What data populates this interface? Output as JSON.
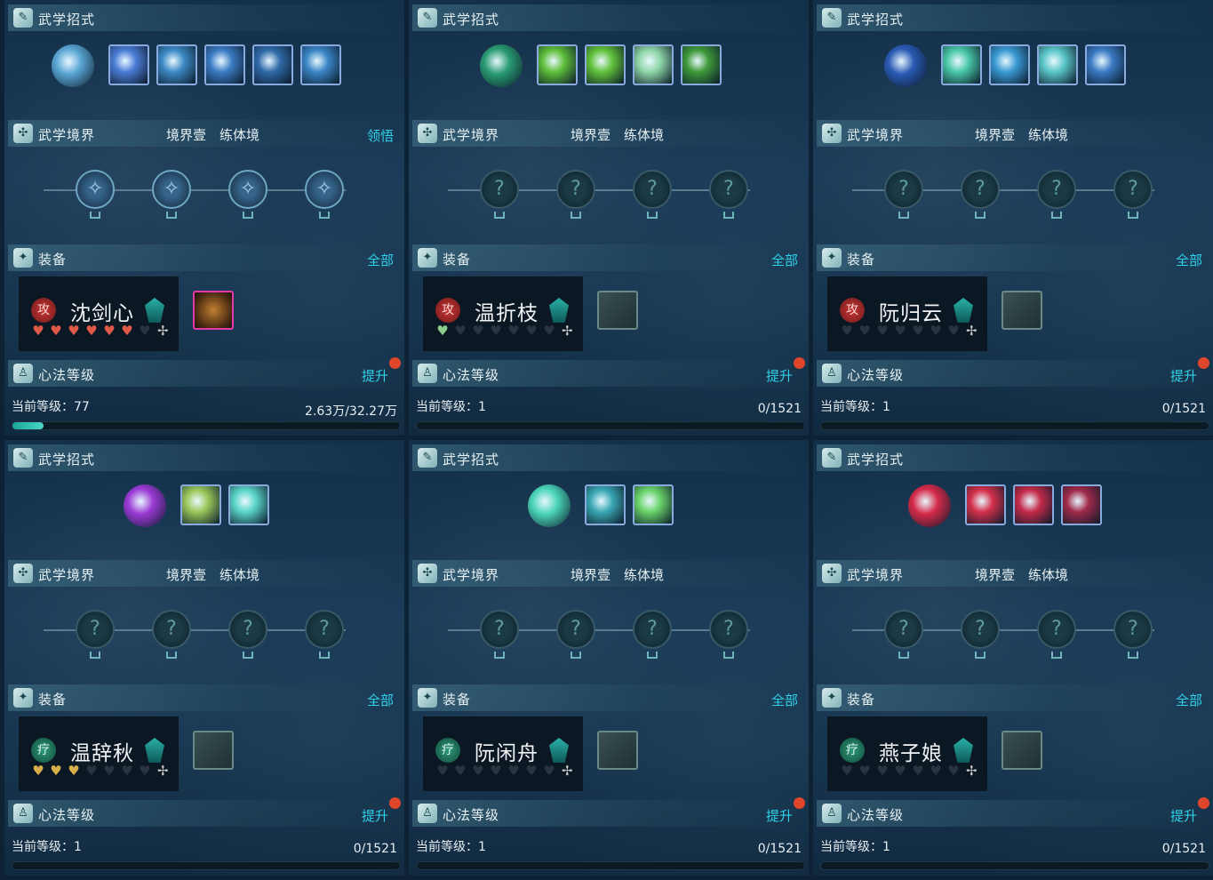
{
  "labels": {
    "skills": "武学招式",
    "realm": "武学境界",
    "gear": "装备",
    "xinfa": "心法等级",
    "all": "全部",
    "upgrade": "提升",
    "comprehend": "领悟",
    "level_prefix": "当前等级："
  },
  "panels": [
    {
      "realm1": "境界壹",
      "realm2": "练体境",
      "realm_action": "领悟",
      "role": "攻",
      "name": "沈剑心",
      "hearts_full": 6,
      "heart_color": "#e05a4a",
      "level": "77",
      "exp": "2.63万/32.27万",
      "progress": 0.08,
      "node_style": "lit",
      "skill_colors": [
        "#5aa6d4",
        "#4a7cd6",
        "#3d8ac6",
        "#3b7cc4",
        "#2f6aa8",
        "#3a86c6"
      ],
      "rare": true
    },
    {
      "realm1": "境界壹",
      "realm2": "练体境",
      "realm_action": "",
      "role": "攻",
      "name": "温折枝",
      "hearts_full": 1,
      "heart_color": "#8ccf8c",
      "level": "1",
      "exp": "0/1521",
      "progress": 0,
      "node_style": "dim",
      "skill_colors": [
        "#2a9a72",
        "#5fbf3a",
        "#62c23a",
        "#8fd6a8",
        "#3f9a3a"
      ],
      "rare": false
    },
    {
      "realm1": "境界壹",
      "realm2": "练体境",
      "realm_action": "",
      "role": "攻",
      "name": "阮归云",
      "hearts_full": 0,
      "heart_color": "#888",
      "level": "1",
      "exp": "0/1521",
      "progress": 0,
      "node_style": "dim",
      "skill_colors": [
        "#2a5ab4",
        "#4ac8a8",
        "#3a9ad4",
        "#5ac6c8",
        "#3a7ac4"
      ],
      "rare": false
    },
    {
      "realm1": "境界壹",
      "realm2": "练体境",
      "realm_action": "",
      "role": "疗",
      "name": "温辞秋",
      "hearts_full": 3,
      "heart_color": "#d8b04a",
      "level": "1",
      "exp": "0/1521",
      "progress": 0,
      "node_style": "dim",
      "skill_colors": [
        "#9a3ad4",
        "#9ac85a",
        "#5ad4c8"
      ],
      "rare": false
    },
    {
      "realm1": "境界壹",
      "realm2": "练体境",
      "realm_action": "",
      "role": "疗",
      "name": "阮闲舟",
      "hearts_full": 0,
      "heart_color": "#888",
      "level": "1",
      "exp": "0/1521",
      "progress": 0,
      "node_style": "dim",
      "skill_colors": [
        "#4ad4b8",
        "#3aa8b4",
        "#6ad46a"
      ],
      "rare": false
    },
    {
      "realm1": "境界壹",
      "realm2": "练体境",
      "realm_action": "",
      "role": "疗",
      "name": "燕子娘",
      "hearts_full": 0,
      "heart_color": "#888",
      "level": "1",
      "exp": "0/1521",
      "progress": 0,
      "node_style": "dim",
      "skill_colors": [
        "#d42a4a",
        "#d4304a",
        "#c42a4a",
        "#a02a4a"
      ],
      "rare": false
    }
  ]
}
